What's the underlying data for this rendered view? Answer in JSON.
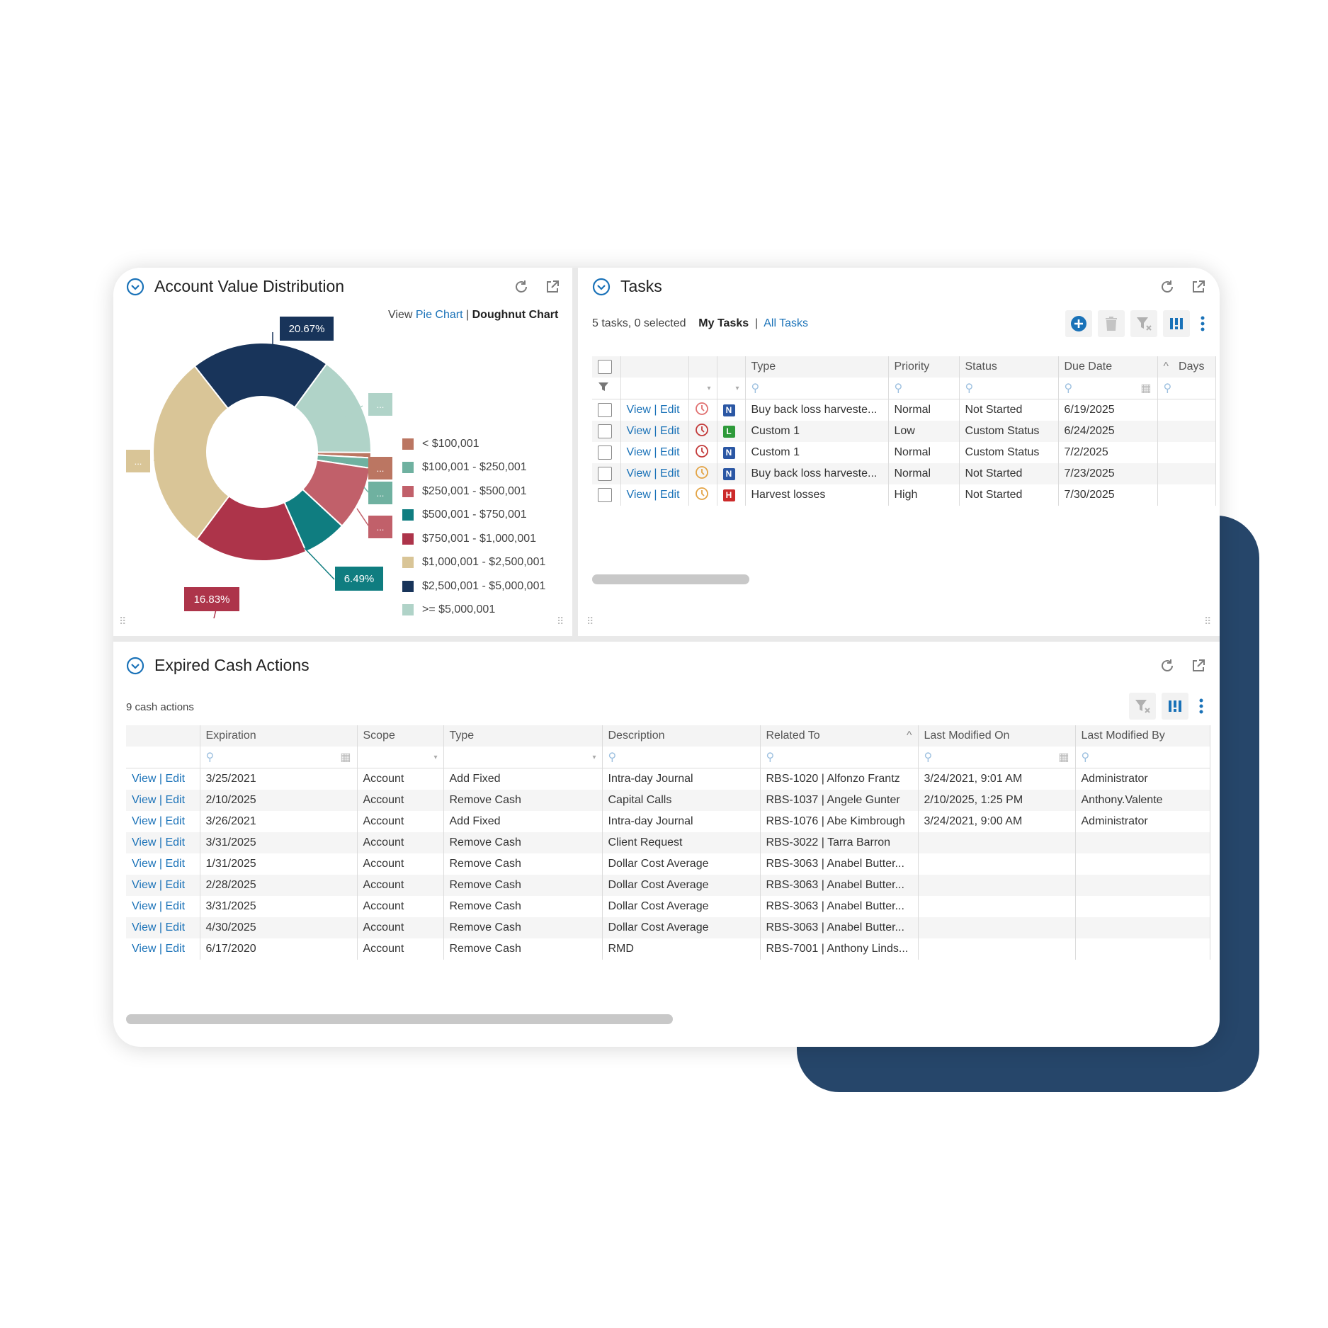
{
  "colors": {
    "navy": "#26466a",
    "link": "#1a72b8",
    "slices": [
      "#bb7662",
      "#6fb1a0",
      "#c1606a",
      "#0f7d80",
      "#ad344a",
      "#d9c597",
      "#18345a",
      "#b0d3c8"
    ]
  },
  "account_value": {
    "title": "Account Value Distribution",
    "view_prefix": "View",
    "view_pie": "Pie Chart",
    "view_sep": "|",
    "view_doughnut": "Doughnut Chart",
    "callouts": [
      "20.67%",
      "6.49%",
      "16.83%"
    ],
    "hidden_label": "..."
  },
  "chart_data": {
    "type": "pie",
    "style": "doughnut",
    "categories": [
      "< $100,001",
      "$100,001 - $250,001",
      "$250,001 - $500,001",
      "$500,001 - $750,001",
      "$750,001 - $1,000,001",
      "$1,000,001 - $2,500,001",
      "$2,500,001 - $5,000,001",
      ">= $5,000,001"
    ],
    "values": [
      0.8,
      1.5,
      9.5,
      6.49,
      16.83,
      29.2,
      20.67,
      15.0
    ],
    "data_labels": [
      "...",
      "...",
      "...",
      "6.49%",
      "16.83%",
      "...",
      "20.67%",
      "..."
    ],
    "legend": "right"
  },
  "tasks": {
    "title": "Tasks",
    "summary": "5 tasks, 0 selected",
    "my_tasks": "My Tasks",
    "sep": "|",
    "all_tasks": "All Tasks",
    "columns": [
      "Type",
      "Priority",
      "Status",
      "Due Date",
      "Days"
    ],
    "view_label": "View",
    "edit_label": "Edit",
    "rows": [
      {
        "type": "Buy back loss harveste...",
        "priority": "Normal",
        "status": "Not Started",
        "due": "6/19/2025",
        "badge": "N",
        "badge_color": "#2b57a4",
        "status_icon": "clock-outline-icon",
        "icon_color": "#e07070"
      },
      {
        "type": "Custom 1",
        "priority": "Low",
        "status": "Custom Status",
        "due": "6/24/2025",
        "badge": "L",
        "badge_color": "#2e9a3a",
        "status_icon": "clock-overdue-icon",
        "icon_color": "#c33a3a"
      },
      {
        "type": "Custom 1",
        "priority": "Normal",
        "status": "Custom Status",
        "due": "7/2/2025",
        "badge": "N",
        "badge_color": "#2b57a4",
        "status_icon": "clock-overdue-icon",
        "icon_color": "#c33a3a"
      },
      {
        "type": "Buy back loss harveste...",
        "priority": "Normal",
        "status": "Not Started",
        "due": "7/23/2025",
        "badge": "N",
        "badge_color": "#2b57a4",
        "status_icon": "clock-outline-icon",
        "icon_color": "#e3a445"
      },
      {
        "type": "Harvest losses",
        "priority": "High",
        "status": "Not Started",
        "due": "7/30/2025",
        "badge": "H",
        "badge_color": "#cc2a2a",
        "status_icon": "clock-outline-icon",
        "icon_color": "#e3a445"
      }
    ]
  },
  "expired": {
    "title": "Expired Cash Actions",
    "summary": "9 cash actions",
    "columns": [
      "Expiration",
      "Scope",
      "Type",
      "Description",
      "Related To",
      "Last Modified On",
      "Last Modified By"
    ],
    "view_label": "View",
    "edit_label": "Edit",
    "sep": "|",
    "rows": [
      {
        "expiration": "3/25/2021",
        "scope": "Account",
        "type": "Add Fixed",
        "description": "Intra-day Journal",
        "related": "RBS-1020 | Alfonzo Frantz",
        "modified_on": "3/24/2021, 9:01 AM",
        "modified_by": "Administrator"
      },
      {
        "expiration": "2/10/2025",
        "scope": "Account",
        "type": "Remove Cash",
        "description": "Capital Calls",
        "related": "RBS-1037 | Angele Gunter",
        "modified_on": "2/10/2025, 1:25 PM",
        "modified_by": "Anthony.Valente"
      },
      {
        "expiration": "3/26/2021",
        "scope": "Account",
        "type": "Add Fixed",
        "description": "Intra-day Journal",
        "related": "RBS-1076 | Abe Kimbrough",
        "modified_on": "3/24/2021, 9:00 AM",
        "modified_by": "Administrator"
      },
      {
        "expiration": "3/31/2025",
        "scope": "Account",
        "type": "Remove Cash",
        "description": "Client Request",
        "related": "RBS-3022 | Tarra Barron",
        "modified_on": "",
        "modified_by": ""
      },
      {
        "expiration": "1/31/2025",
        "scope": "Account",
        "type": "Remove Cash",
        "description": "Dollar Cost Average",
        "related": "RBS-3063 | Anabel Butter...",
        "modified_on": "",
        "modified_by": ""
      },
      {
        "expiration": "2/28/2025",
        "scope": "Account",
        "type": "Remove Cash",
        "description": "Dollar Cost Average",
        "related": "RBS-3063 | Anabel Butter...",
        "modified_on": "",
        "modified_by": ""
      },
      {
        "expiration": "3/31/2025",
        "scope": "Account",
        "type": "Remove Cash",
        "description": "Dollar Cost Average",
        "related": "RBS-3063 | Anabel Butter...",
        "modified_on": "",
        "modified_by": ""
      },
      {
        "expiration": "4/30/2025",
        "scope": "Account",
        "type": "Remove Cash",
        "description": "Dollar Cost Average",
        "related": "RBS-3063 | Anabel Butter...",
        "modified_on": "",
        "modified_by": ""
      },
      {
        "expiration": "6/17/2020",
        "scope": "Account",
        "type": "Remove Cash",
        "description": "RMD",
        "related": "RBS-7001 | Anthony Linds...",
        "modified_on": "",
        "modified_by": ""
      }
    ]
  }
}
